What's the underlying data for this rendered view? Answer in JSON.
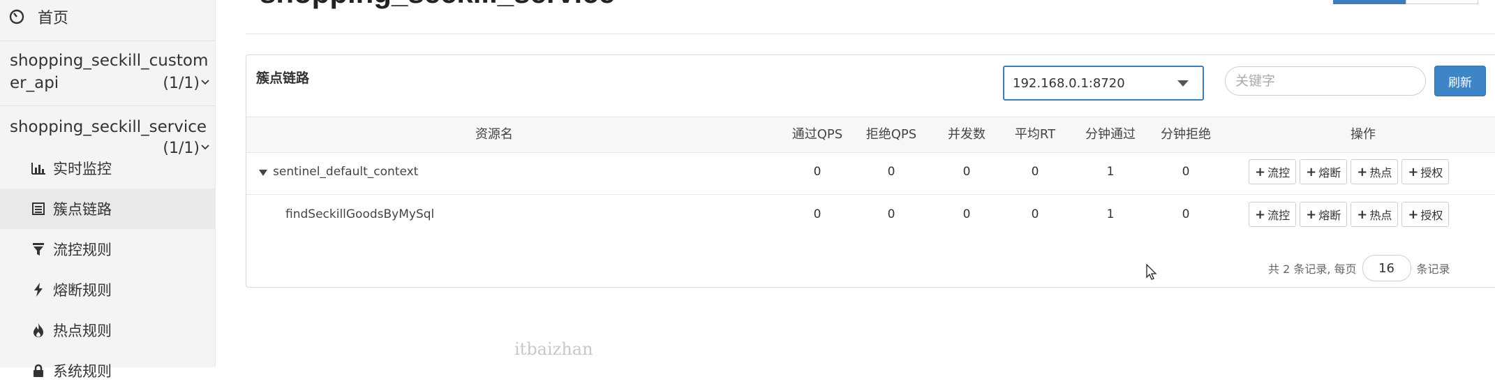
{
  "page": {
    "title": "shopping_seckill_service"
  },
  "sidebar": {
    "home": {
      "label": "首页",
      "icon": "dashboard-icon"
    },
    "apps": [
      {
        "name_line1": "shopping_seckill_custom",
        "name_line2": "er_api",
        "count": "(1/1)"
      },
      {
        "name_line1": "shopping_seckill_service",
        "count": "(1/1)"
      }
    ],
    "items": [
      {
        "label": "实时监控",
        "icon": "bar-chart-icon"
      },
      {
        "label": "簇点链路",
        "icon": "list-icon",
        "active": true
      },
      {
        "label": "流控规则",
        "icon": "filter-icon"
      },
      {
        "label": "熔断规则",
        "icon": "bolt-icon"
      },
      {
        "label": "热点规则",
        "icon": "fire-icon"
      },
      {
        "label": "系统规则",
        "icon": "lock-icon"
      }
    ]
  },
  "panel": {
    "title": "簇点链路",
    "machine": "192.168.0.1:8720",
    "keyword_placeholder": "关键字",
    "refresh_label": "刷新"
  },
  "table": {
    "headers": [
      "资源名",
      "通过QPS",
      "拒绝QPS",
      "并发数",
      "平均RT",
      "分钟通过",
      "分钟拒绝",
      "操作"
    ],
    "rows": [
      {
        "resource": "sentinel_default_context",
        "pass_qps": "0",
        "block_qps": "0",
        "concurrency": "0",
        "avg_rt": "0",
        "minute_pass": "1",
        "minute_block": "0"
      },
      {
        "resource": "findSeckillGoodsByMySql",
        "pass_qps": "0",
        "block_qps": "0",
        "concurrency": "0",
        "avg_rt": "0",
        "minute_pass": "1",
        "minute_block": "0"
      }
    ],
    "actions": [
      "流控",
      "熔断",
      "热点",
      "授权"
    ]
  },
  "pagination": {
    "prefix": "共 2 条记录, 每页",
    "page_size": "16",
    "suffix": "条记录"
  },
  "watermark": "itbaizhan",
  "colors": {
    "primary": "#3d85c6",
    "sidebar_bg": "#f3f4f3"
  }
}
